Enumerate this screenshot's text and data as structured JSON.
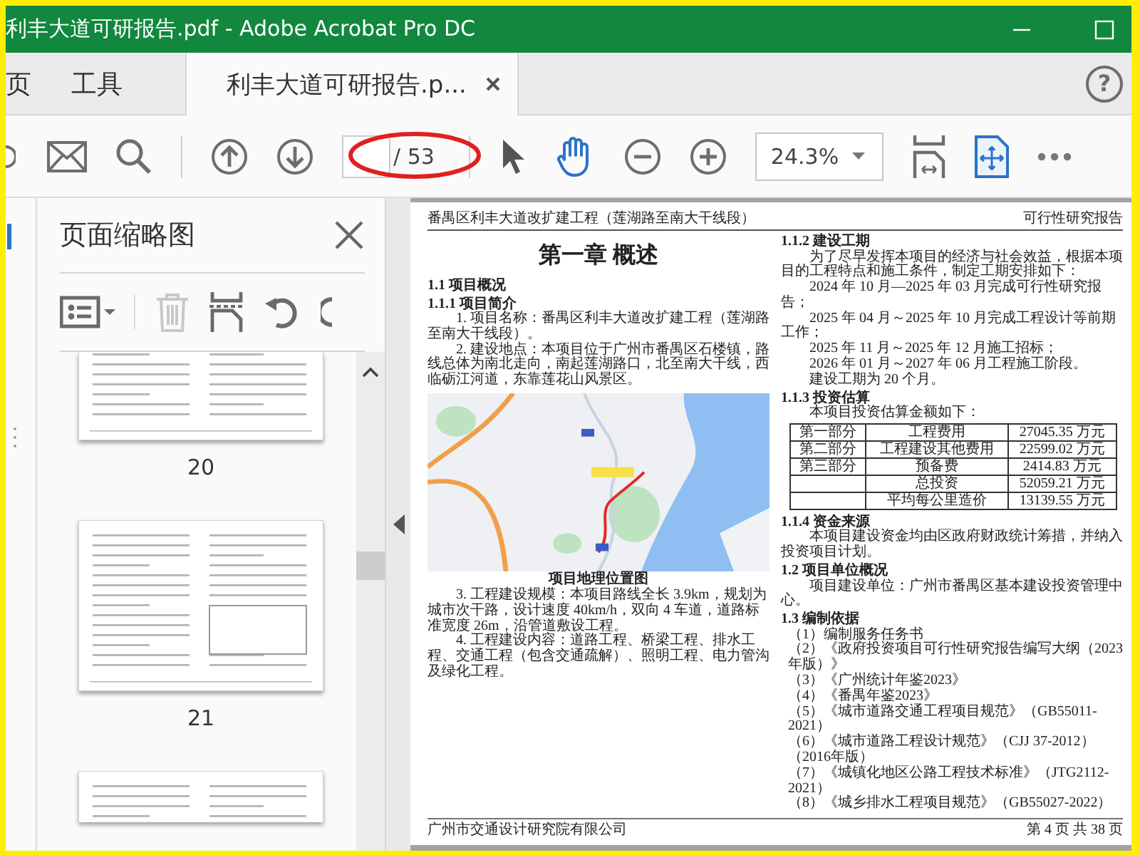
{
  "window": {
    "title": "利丰大道可研报告.pdf - Adobe Acrobat Pro DC"
  },
  "tabs": [
    {
      "label": "页",
      "selected": false
    },
    {
      "label": "工具",
      "selected": false
    },
    {
      "label": "利丰大道可研报告.p...",
      "selected": true
    }
  ],
  "help": "?",
  "toolbar": {
    "page_total": "/ 53",
    "zoom": "24.3%"
  },
  "thumbnails_panel": {
    "title": "页面缩略图",
    "tools": [
      {
        "kind": "options",
        "disabled": false
      },
      {
        "kind": "delete",
        "disabled": true
      },
      {
        "kind": "insert",
        "disabled": false
      },
      {
        "kind": "rotate_left",
        "disabled": false
      },
      {
        "kind": "rotate_right",
        "disabled": false
      }
    ],
    "pages": [
      {
        "kind": "top_cut",
        "label": "20"
      },
      {
        "kind": "whole",
        "label": "21"
      },
      {
        "kind": "bottom_cut"
      }
    ]
  },
  "document": {
    "header_left": "番禺区利丰大道改扩建工程（莲湖路至南大干线段）",
    "header_right": "可行性研究报告",
    "left_column": [
      {
        "kind": "title",
        "text": "第一章 概述"
      },
      {
        "kind": "heading",
        "text": "1.1 项目概况"
      },
      {
        "kind": "heading",
        "text": "1.1.1 项目简介"
      },
      {
        "kind": "para",
        "text": "1. 项目名称：番禺区利丰大道改扩建工程（莲湖路至南大干线段）。"
      },
      {
        "kind": "para",
        "text": "2. 建设地点：本项目位于广州市番禺区石楼镇，路线总体为南北走向，南起莲湖路口，北至南大干线，西临砺江河道，东靠莲花山风景区。"
      },
      {
        "kind": "figure",
        "caption": "项目地理位置图"
      },
      {
        "kind": "para",
        "text": "3. 工程建设规模：本项目路线全长 3.9km，规划为城市次干路，设计速度 40km/h，双向 4 车道，道路标准宽度 26m，沿管道敷设工程。"
      },
      {
        "kind": "para",
        "text": "4. 工程建设内容：道路工程、桥梁工程、排水工程、交通工程（包含交通疏解）、照明工程、电力管沟及绿化工程。"
      }
    ],
    "right_column": [
      {
        "kind": "heading",
        "text": "1.1.2 建设工期"
      },
      {
        "kind": "para",
        "text": "为了尽早发挥本项目的经济与社会效益，根据本项目的工程特点和施工条件，制定工期安排如下："
      },
      {
        "kind": "line",
        "text": "2024 年 10 月—2025 年 03 月完成可行性研究报告；"
      },
      {
        "kind": "line",
        "text": "2025 年 04 月～2025 年 10 月完成工程设计等前期工作；"
      },
      {
        "kind": "line",
        "text": "2025 年 11 月～2025 年 12 月施工招标；"
      },
      {
        "kind": "line",
        "text": "2026 年 01 月～2027 年 06 月工程施工阶段。"
      },
      {
        "kind": "line",
        "text": "建设工期为 20 个月。"
      },
      {
        "kind": "heading",
        "text": "1.1.3 投资估算"
      },
      {
        "kind": "line",
        "text": "本项目投资估算金额如下："
      },
      {
        "kind": "table",
        "rows": [
          {
            "part": "第一部分",
            "item": "工程费用",
            "amount": "27045.35 万元"
          },
          {
            "part": "第二部分",
            "item": "工程建设其他费用",
            "amount": "22599.02 万元"
          },
          {
            "part": "第三部分",
            "item": "预备费",
            "amount": "2414.83 万元"
          },
          {
            "item": "总投资",
            "amount": "52059.21 万元"
          },
          {
            "item": "平均每公里造价",
            "amount": "13139.55 万元"
          }
        ]
      },
      {
        "kind": "heading",
        "text": "1.1.4 资金来源"
      },
      {
        "kind": "para",
        "text": "本项目建设资金均由区政府财政统计筹措，并纳入投资项目计划。"
      },
      {
        "kind": "heading",
        "text": "1.2 项目单位概况"
      },
      {
        "kind": "para",
        "text": "项目建设单位：广州市番禺区基本建设投资管理中心。"
      },
      {
        "kind": "heading",
        "text": "1.3 编制依据"
      },
      {
        "kind": "item",
        "text": "（1）编制服务任务书"
      },
      {
        "kind": "item",
        "text": "（2）《政府投资项目可行性研究报告编写大纲（2023年版）》"
      },
      {
        "kind": "item",
        "text": "（3）《广州统计年鉴2023》"
      },
      {
        "kind": "item",
        "text": "（4）《番禺年鉴2023》"
      },
      {
        "kind": "item",
        "text": "（5）《城市道路交通工程项目规范》（GB55011-2021）"
      },
      {
        "kind": "item",
        "text": "（6）《城市道路工程设计规范》（CJJ 37-2012）（2016年版）"
      },
      {
        "kind": "item",
        "text": "（7）《城镇化地区公路工程技术标准》（JTG2112-2021）"
      },
      {
        "kind": "item",
        "text": "（8）《城乡排水工程项目规范》（GB55027-2022）"
      }
    ],
    "footer_left": "广州市交通设计研究院有限公司",
    "footer_right": "第 4 页 共 38 页"
  }
}
